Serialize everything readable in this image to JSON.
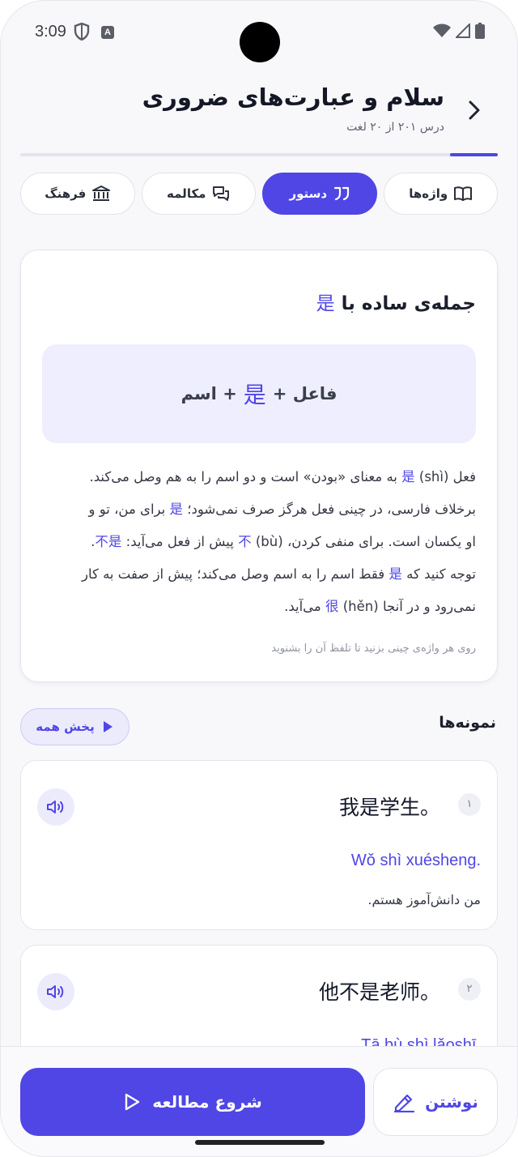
{
  "status": {
    "time": "3:09",
    "a_icon": "A"
  },
  "header": {
    "title": "سلام و عبارت‌های ضروری",
    "subtitle": "درس ۲۰۱ از ۲۰ لغت",
    "progress": 0.1
  },
  "tabs": [
    {
      "label": "واژه‌ها",
      "icon": "book-icon",
      "active": false
    },
    {
      "label": "دستور",
      "icon": "quote-icon",
      "active": true
    },
    {
      "label": "مکالمه",
      "icon": "chat-icon",
      "active": false
    },
    {
      "label": "فرهنگ",
      "icon": "museum-icon",
      "active": false
    }
  ],
  "grammar": {
    "title_text": "جمله‌ی ساده با",
    "title_han": "是",
    "formula": {
      "left": "فاعل +",
      "han": "是",
      "right": "+ اسم"
    },
    "lines": [
      {
        "a": "فعل",
        "h1": "是",
        "b": "(shì) به معنای «بودن» است و دو اسم را به هم وصل می‌کند."
      },
      {
        "a": "برخلاف فارسی، در چینی فعل هرگز صرف نمی‌شود؛",
        "h1": "是",
        "b": "برای من، تو و"
      },
      {
        "a": "او یکسان است. برای منفی کردن،",
        "h1": "不",
        "b": "(bù) پیش از فعل می‌آید:",
        "h2": "不是",
        "c": "."
      },
      {
        "a": "توجه کنید که",
        "h1": "是",
        "b": "فقط اسم را به اسم وصل می‌کند؛ پیش از صفت به کار"
      },
      {
        "a": "نمی‌رود و در آنجا",
        "h1": "很",
        "b": "(hěn) می‌آید."
      }
    ],
    "hint": "روی هر واژه‌ی چینی بزنید تا تلفظ آن را بشنوید"
  },
  "examples": {
    "title": "نمونه‌ها",
    "play_all": "پخش همه",
    "items": [
      {
        "num": "۱",
        "zh": "我是学生。",
        "pinyin": "Wǒ shì xuésheng.",
        "fa": "من دانش‌آموز هستم."
      },
      {
        "num": "۲",
        "zh": "他不是老师。",
        "pinyin": "Tā bù shì lǎoshī.",
        "fa": ""
      }
    ]
  },
  "bottom": {
    "start": "شروع مطالعه",
    "write": "نوشتن"
  },
  "colors": {
    "accent": "#4f46e5",
    "accent_soft": "#efeefe"
  }
}
